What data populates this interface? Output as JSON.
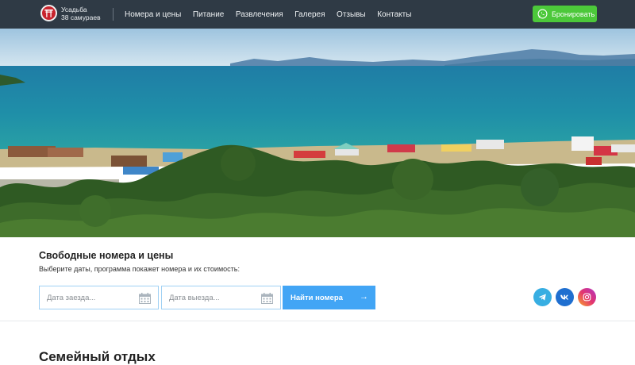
{
  "header": {
    "brand_line1": "Усадьба",
    "brand_line2": "38 самураев",
    "nav": [
      "Номера и цены",
      "Питание",
      "Развлечения",
      "Галерея",
      "Отзывы",
      "Контакты"
    ],
    "book_label": "Бронировать"
  },
  "search": {
    "title": "Свободные номера и цены",
    "subtitle": "Выберите даты, программа покажет номера и их стоимость:",
    "checkin_placeholder": "Дата заезда...",
    "checkout_placeholder": "Дата выезда...",
    "find_label": "Найти номера",
    "arrow": "→"
  },
  "next_section": {
    "title": "Семейный отдых"
  },
  "colors": {
    "header_bg": "#2f3a45",
    "book_green": "#4cc83a",
    "find_blue": "#42a5f5",
    "telegram": "#37aee2",
    "vk": "#1f6fd0"
  },
  "icons": [
    "logo-torii-icon",
    "whatsapp-icon",
    "calendar-icon",
    "arrow-right-icon",
    "telegram-icon",
    "vk-icon",
    "instagram-icon"
  ]
}
